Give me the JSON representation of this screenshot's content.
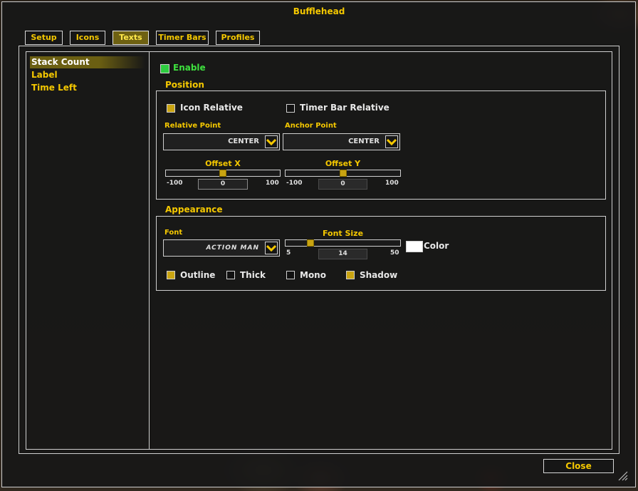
{
  "window": {
    "title": "Bufflehead"
  },
  "tabs": [
    {
      "label": "Setup"
    },
    {
      "label": "Icons"
    },
    {
      "label": "Texts"
    },
    {
      "label": "Timer Bars"
    },
    {
      "label": "Profiles"
    }
  ],
  "active_tab": "Texts",
  "sidebar": {
    "items": [
      {
        "label": "Stack Count"
      },
      {
        "label": "Label"
      },
      {
        "label": "Time Left"
      }
    ],
    "selected": "Stack Count"
  },
  "enable": {
    "label": "Enable",
    "checked": true
  },
  "position": {
    "title": "Position",
    "icon_relative": {
      "label": "Icon Relative",
      "checked": true
    },
    "timer_bar_relative": {
      "label": "Timer Bar Relative",
      "checked": false
    },
    "relative_point": {
      "label": "Relative Point",
      "value": "CENTER"
    },
    "anchor_point": {
      "label": "Anchor Point",
      "value": "CENTER"
    },
    "offset_x": {
      "label": "Offset X",
      "min": "-100",
      "max": "100",
      "value": "0"
    },
    "offset_y": {
      "label": "Offset Y",
      "min": "-100",
      "max": "100",
      "value": "0"
    }
  },
  "appearance": {
    "title": "Appearance",
    "font": {
      "label": "Font",
      "value": "ACTION MAN"
    },
    "font_size": {
      "label": "Font Size",
      "min": "5",
      "max": "50",
      "value": "14"
    },
    "color": {
      "label": "Color",
      "value": "#ffffff"
    },
    "outline": {
      "label": "Outline",
      "checked": true
    },
    "thick": {
      "label": "Thick",
      "checked": false
    },
    "mono": {
      "label": "Mono",
      "checked": false
    },
    "shadow": {
      "label": "Shadow",
      "checked": true
    }
  },
  "close_button": {
    "label": "Close"
  },
  "colors": {
    "accent": "#f5c800",
    "active_tab": "#6e6112",
    "enable_green": "#2ecc40",
    "checkbox_gold": "#c9a412"
  },
  "icons": {
    "dropdown": "chevron-down-icon",
    "resize": "resize-grip-icon"
  }
}
